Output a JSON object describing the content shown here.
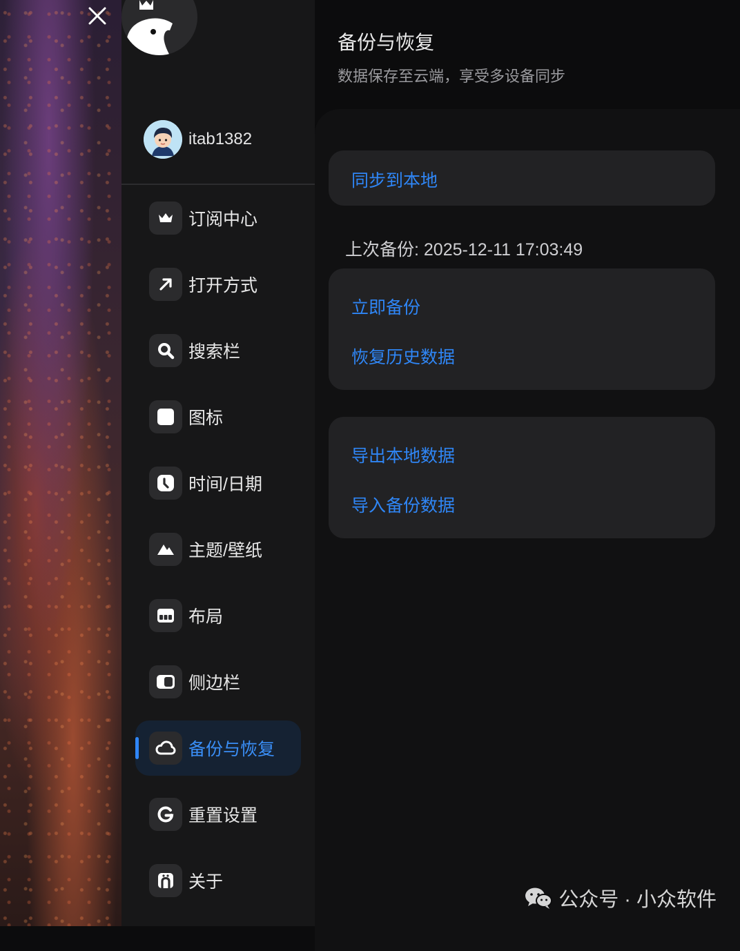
{
  "window": {
    "close_icon": "close-icon"
  },
  "sidebar": {
    "logo_icon": "bird-crown-logo",
    "user": {
      "name": "itab1382",
      "avatar_icon": "avatar-boy"
    },
    "items": [
      {
        "label": "订阅中心",
        "icon": "crown-icon",
        "active": false
      },
      {
        "label": "打开方式",
        "icon": "arrow-up-right-icon",
        "active": false
      },
      {
        "label": "搜索栏",
        "icon": "search-icon",
        "active": false
      },
      {
        "label": "图标",
        "icon": "square-icon",
        "active": false
      },
      {
        "label": "时间/日期",
        "icon": "clock-icon",
        "active": false
      },
      {
        "label": "主题/壁纸",
        "icon": "mountain-icon",
        "active": false
      },
      {
        "label": "布局",
        "icon": "layout-icon",
        "active": false
      },
      {
        "label": "侧边栏",
        "icon": "sidebar-toggle-icon",
        "active": false
      },
      {
        "label": "备份与恢复",
        "icon": "cloud-icon",
        "active": true
      },
      {
        "label": "重置设置",
        "icon": "reset-icon",
        "active": false
      },
      {
        "label": "关于",
        "icon": "about-icon",
        "active": false
      }
    ]
  },
  "content": {
    "title": "备份与恢复",
    "subtitle": "数据保存至云端，享受多设备同步",
    "sync_label": "同步到本地",
    "last_backup": "上次备份: 2025-12-11 17:03:49",
    "backup_now_label": "立即备份",
    "restore_label": "恢复历史数据",
    "export_label": "导出本地数据",
    "import_label": "导入备份数据"
  },
  "watermark": {
    "text": "公众号 · 小众软件",
    "icon": "wechat-icon"
  },
  "colors": {
    "accent": "#2f86f6",
    "sidebar_bg": "#171718",
    "card_bg": "#222224"
  }
}
